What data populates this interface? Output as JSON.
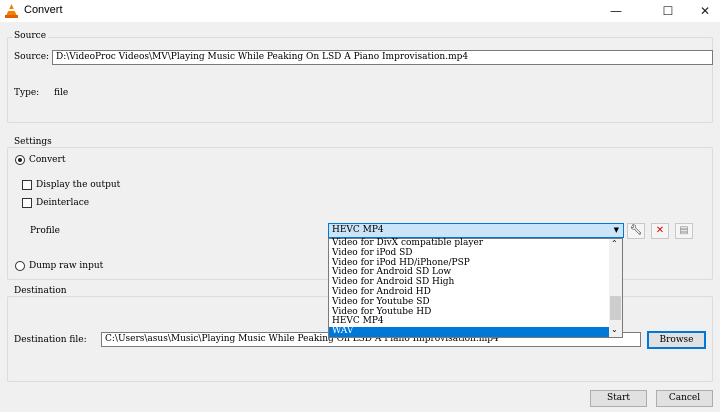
{
  "window": {
    "title": "Convert",
    "minimize": "—",
    "maximize": "☐",
    "close": "✕"
  },
  "source": {
    "group": "Source",
    "label": "Source:",
    "value": "D:\\VideoProc Videos\\MV\\Playing Music While Peaking On LSD  A Piano Improvisation.mp4",
    "type_label": "Type:",
    "type_value": "file"
  },
  "settings": {
    "group": "Settings",
    "convert": "Convert",
    "display_output": "Display the output",
    "deinterlace": "Deinterlace",
    "profile_label": "Profile",
    "profile_selected": "HEVC MP4",
    "dump_raw": "Dump raw input",
    "profile_options": [
      "Video for DivX compatible player",
      "Video for iPod SD",
      "Video for iPod HD/iPhone/PSP",
      "Video for Android SD Low",
      "Video for Android SD High",
      "Video for Android HD",
      "Video for Youtube SD",
      "Video for Youtube HD",
      "HEVC MP4",
      "WAV"
    ],
    "highlighted_option": "WAV"
  },
  "destination": {
    "group": "Destination",
    "label": "Destination file:",
    "value": "C:\\Users\\asus\\Music\\Playing Music While Peaking On LSD  A Piano Improvisation.mp4",
    "browse": "Browse"
  },
  "footer": {
    "start": "Start",
    "cancel": "Cancel"
  }
}
